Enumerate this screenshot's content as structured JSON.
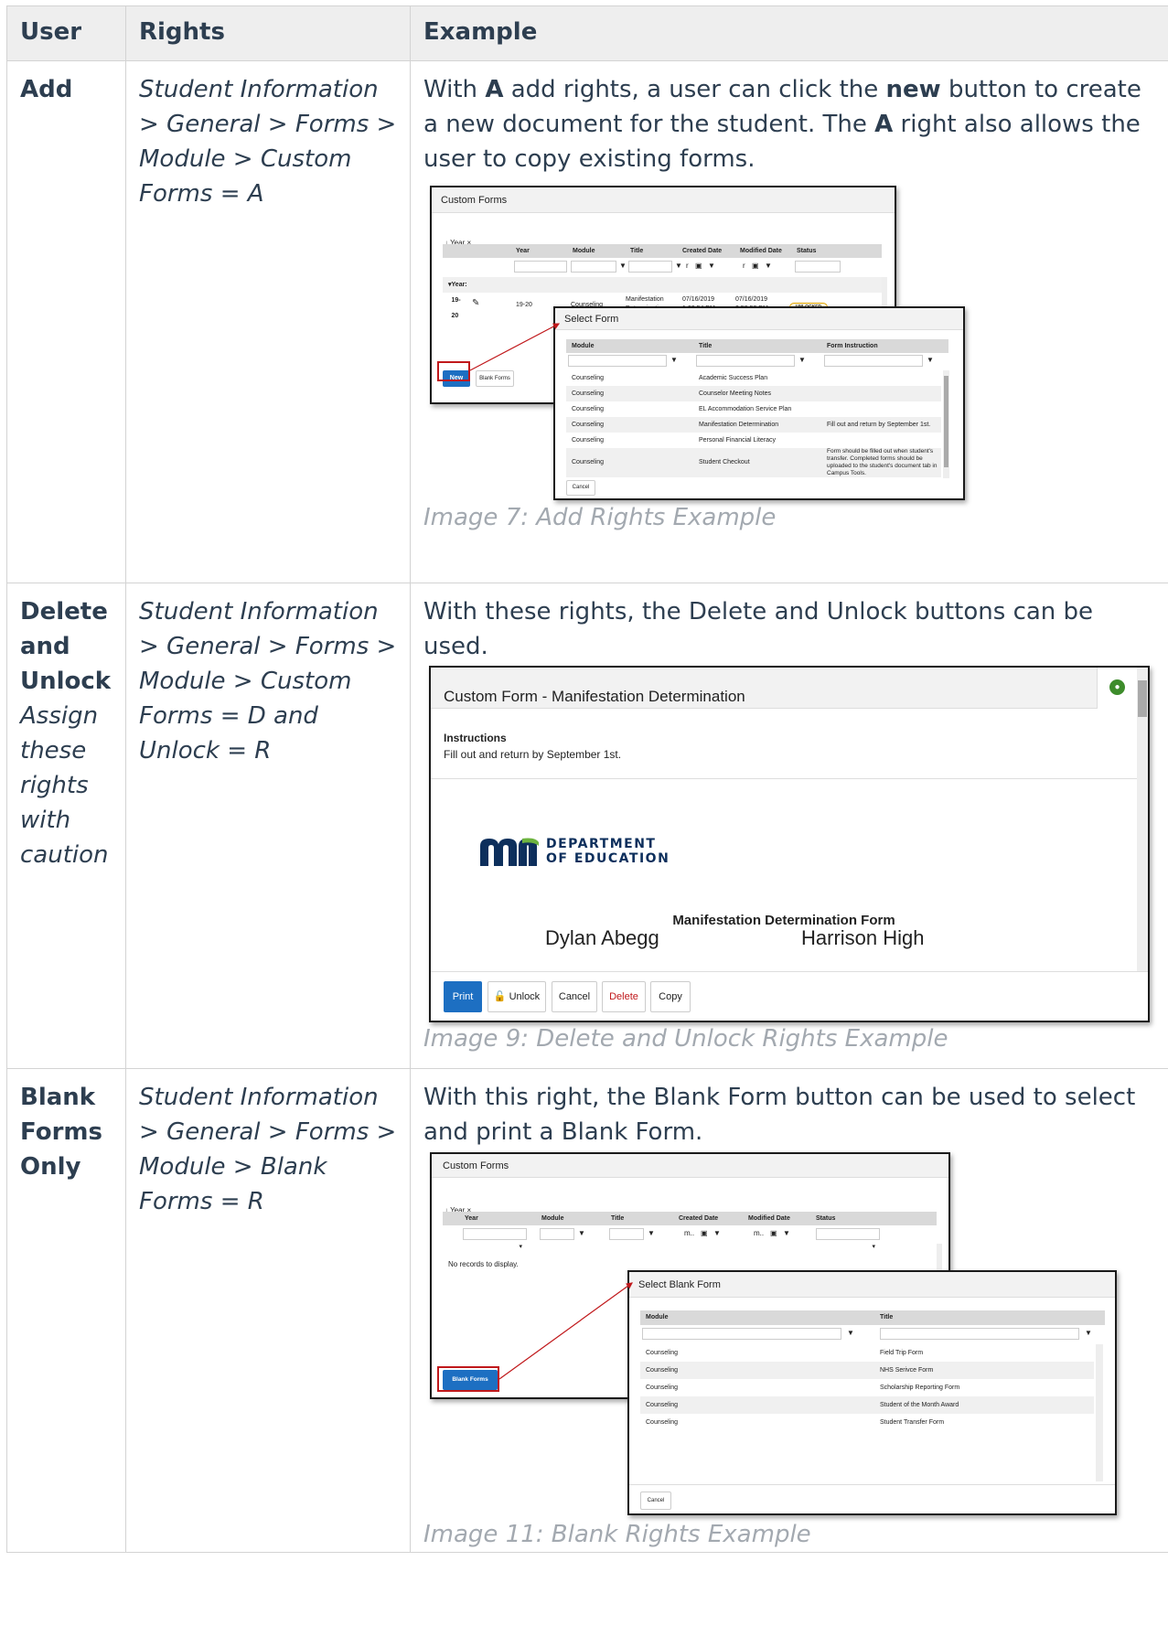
{
  "table": {
    "headers": {
      "user": "User",
      "rights": "Rights",
      "example": "Example"
    },
    "rows": [
      {
        "user": "Add",
        "rights": "Student Information > General > Forms > Module > Custom Forms = A",
        "desc": {
          "t1": "With ",
          "b1": "A",
          "t2": " add rights, a user can click the ",
          "b2": "new",
          "t3": " button to create a new document for the student. The ",
          "b3": "A",
          "t4": " right also allows the user to copy existing forms."
        },
        "caption": "Image 7: Add Rights Example"
      },
      {
        "user": "Delete and Unlock",
        "user_note": "Assign these rights with caution",
        "rights": "Student Information > General > Forms > Module > Custom Forms = D and Unlock = R",
        "desc": "With these rights, the Delete and Unlock buttons can be used.",
        "caption": "Image 9: Delete and Unlock Rights Example"
      },
      {
        "user": "Blank Forms Only",
        "rights": "Student Information > General > Forms > Module > Blank Forms = R",
        "desc": "With this right, the Blank Form button can be used to select and print a Blank Form.",
        "caption": "Image 11: Blank Rights Example"
      }
    ]
  },
  "shot1": {
    "window_title": "Custom Forms",
    "group_chip": "Year",
    "columns": [
      "Year",
      "Module",
      "Title",
      "Created Date",
      "Modified Date",
      "Status"
    ],
    "filter_prefix": "r",
    "group_label": "Year: 19-20",
    "row": {
      "year": "19-20",
      "module": "Counseling",
      "title": "Manifestation Determination",
      "created": "07/16/2019 1:02:54 PM",
      "modified": "07/16/2019 2:58:53 PM",
      "status": "UNLOCKED"
    },
    "new_button": "New",
    "blank_button": "Blank Forms",
    "select": {
      "title": "Select Form",
      "columns": [
        "Module",
        "Title",
        "Form Instruction"
      ],
      "rows": [
        {
          "module": "Counseling",
          "title": "Academic Success Plan",
          "instruction": ""
        },
        {
          "module": "Counseling",
          "title": "Counselor Meeting Notes",
          "instruction": ""
        },
        {
          "module": "Counseling",
          "title": "EL Accommodation Service Plan",
          "instruction": ""
        },
        {
          "module": "Counseling",
          "title": "Manifestation Determination",
          "instruction": "Fill out and return by September 1st."
        },
        {
          "module": "Counseling",
          "title": "Personal Financial Literacy",
          "instruction": ""
        },
        {
          "module": "Counseling",
          "title": "Student Checkout",
          "instruction": "Form should be filled out when student's transfer. Completed forms should be uploaded to the student's document tab in Campus Tools."
        }
      ],
      "cancel": "Cancel"
    }
  },
  "shot2": {
    "window_title": "Custom Form - Manifestation Determination",
    "instructions_label": "Instructions",
    "instructions_text": "Fill out and return by September 1st.",
    "logo_text_1": "DEPARTMENT",
    "logo_text_2": "OF EDUCATION",
    "form_heading": "Manifestation Determination Form",
    "student_name": "Dylan Abegg",
    "school_name": "Harrison High",
    "buttons": {
      "print": "Print",
      "unlock": "Unlock",
      "cancel": "Cancel",
      "delete": "Delete",
      "copy": "Copy"
    }
  },
  "shot3": {
    "window_title": "Custom Forms",
    "group_chip": "Year",
    "columns": [
      "Year",
      "Module",
      "Title",
      "Created Date",
      "Modified Date",
      "Status"
    ],
    "filter_prefix": "m..",
    "empty_text": "No records to display.",
    "blank_button": "Blank Forms",
    "select": {
      "title": "Select Blank Form",
      "columns": [
        "Module",
        "Title"
      ],
      "rows": [
        {
          "module": "Counseling",
          "title": "Field Trip Form"
        },
        {
          "module": "Counseling",
          "title": "NHS Serivce Form"
        },
        {
          "module": "Counseling",
          "title": "Scholarship Reporting Form"
        },
        {
          "module": "Counseling",
          "title": "Student of the Month Award"
        },
        {
          "module": "Counseling",
          "title": "Student Transfer Form"
        }
      ],
      "cancel": "Cancel"
    }
  },
  "colors": {
    "accent_blue": "#1d6fc2",
    "highlight_red": "#c0181b",
    "caption_gray": "#a3a9b0",
    "text_navy": "#2d3e50"
  }
}
